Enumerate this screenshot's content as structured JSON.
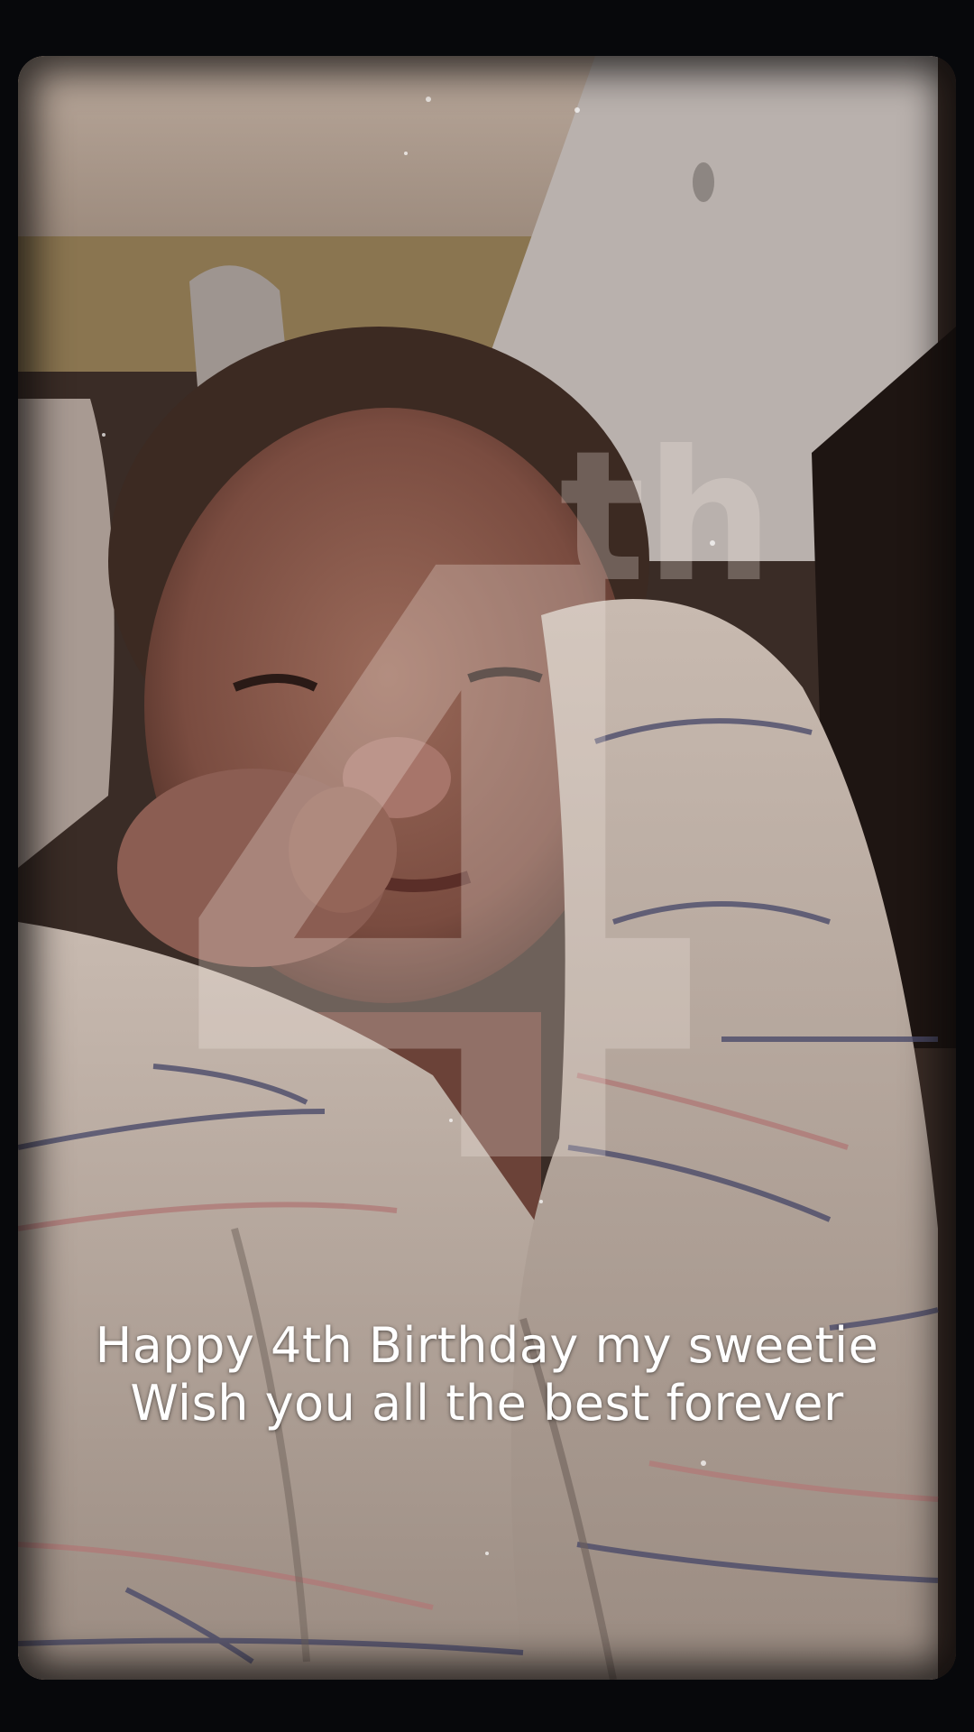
{
  "overlay_graphic": {
    "number": "4",
    "suffix": "th"
  },
  "caption": {
    "line1": "Happy 4th Birthday my sweetie",
    "line2": "Wish you all the best forever"
  },
  "colors": {
    "background": "#07080b",
    "caption_text": "#ffffff"
  }
}
